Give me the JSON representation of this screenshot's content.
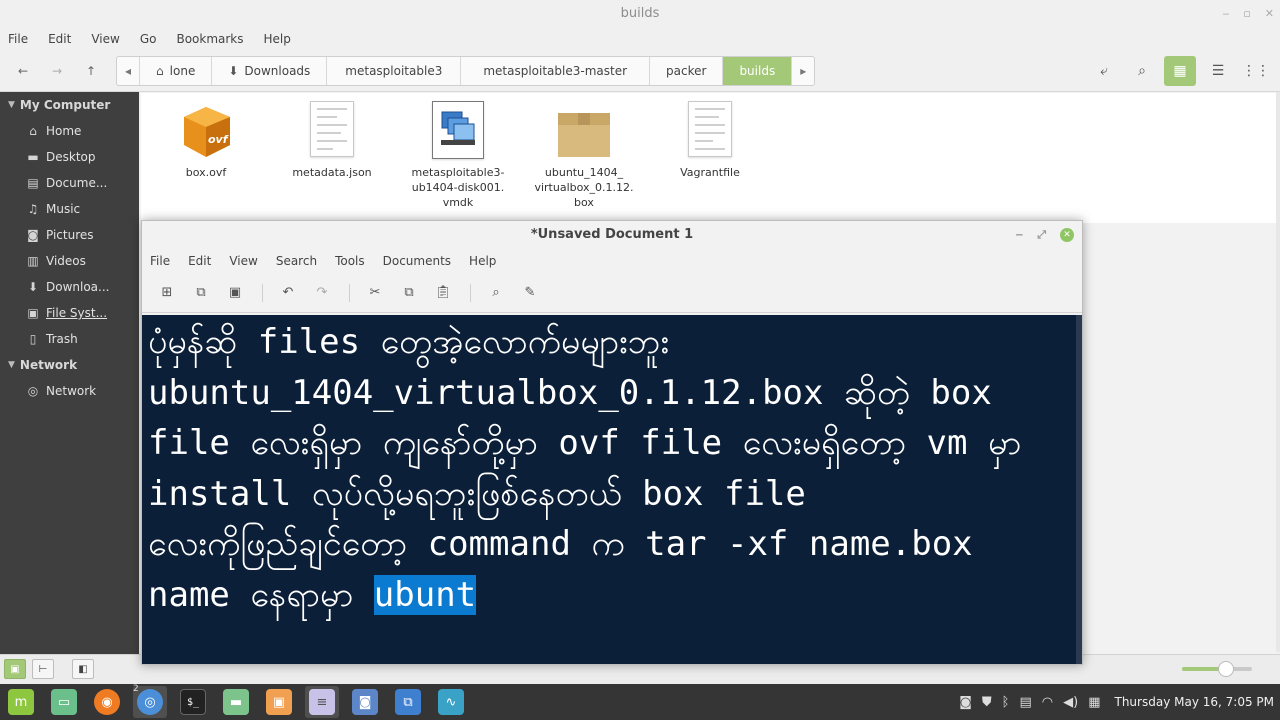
{
  "fm": {
    "title": "builds",
    "menu": [
      "File",
      "Edit",
      "View",
      "Go",
      "Bookmarks",
      "Help"
    ],
    "breadcrumbs": [
      "lone",
      "Downloads",
      "metasploitable3",
      "metasploitable3-master",
      "packer",
      "builds"
    ],
    "sidebar": {
      "computer_header": "My Computer",
      "computer_items": [
        {
          "label": "Home",
          "icon": "home-icon"
        },
        {
          "label": "Desktop",
          "icon": "desktop-icon"
        },
        {
          "label": "Docume...",
          "icon": "documents-icon"
        },
        {
          "label": "Music",
          "icon": "music-icon"
        },
        {
          "label": "Pictures",
          "icon": "camera-icon"
        },
        {
          "label": "Videos",
          "icon": "film-icon"
        },
        {
          "label": "Downloa...",
          "icon": "download-icon"
        },
        {
          "label": "File Syst...",
          "icon": "filesystem-icon"
        },
        {
          "label": "Trash",
          "icon": "trash-icon"
        }
      ],
      "network_header": "Network",
      "network_items": [
        {
          "label": "Network",
          "icon": "network-icon"
        }
      ]
    },
    "files": [
      {
        "name": "box.ovf",
        "icon": "ovf-icon"
      },
      {
        "name": "metadata.json",
        "icon": "text-file-icon"
      },
      {
        "name": "metasploitable3-ub1404-disk001.vmdk",
        "lines": [
          "metasploitable3-",
          "ub1404-disk001.",
          "vmdk"
        ],
        "icon": "vmdk-icon"
      },
      {
        "name": "ubuntu_1404_virtualbox_0.1.12.box",
        "lines": [
          "ubuntu_1404_",
          "virtualbox_0.1.12.",
          "box"
        ],
        "icon": "archive-icon"
      },
      {
        "name": "Vagrantfile",
        "icon": "text-file-icon"
      }
    ]
  },
  "gedit": {
    "title": "*Unsaved Document 1",
    "menu": [
      "File",
      "Edit",
      "View",
      "Search",
      "Tools",
      "Documents",
      "Help"
    ],
    "lines": [
      "ပုံမှန်ဆို files တွေအဲ့လောက်မများဘူး",
      "ubuntu_1404_virtualbox_0.1.12.box ဆိုတဲ့ box",
      "file လေးရှိမှာ ကျနော်တို့မှာ ovf file လေးမရှိတော့ vm မှာ",
      "install လုပ်လို့မရဘူးဖြစ်နေတယ် box file",
      "လေးကိုဖြည်ချင်တော့ command က tar -xf name.box"
    ],
    "last_line_prefix": "name နေရာမှာ ",
    "selected_text": "ubunt"
  },
  "taskbar": {
    "badge": "2",
    "clock": "Thursday May 16,  7:05 PM"
  },
  "colors": {
    "accent": "#a3c978",
    "editor_bg": "#0c1f38",
    "selection": "#0b7ad1",
    "sidebar_bg": "#3f3f3f"
  }
}
